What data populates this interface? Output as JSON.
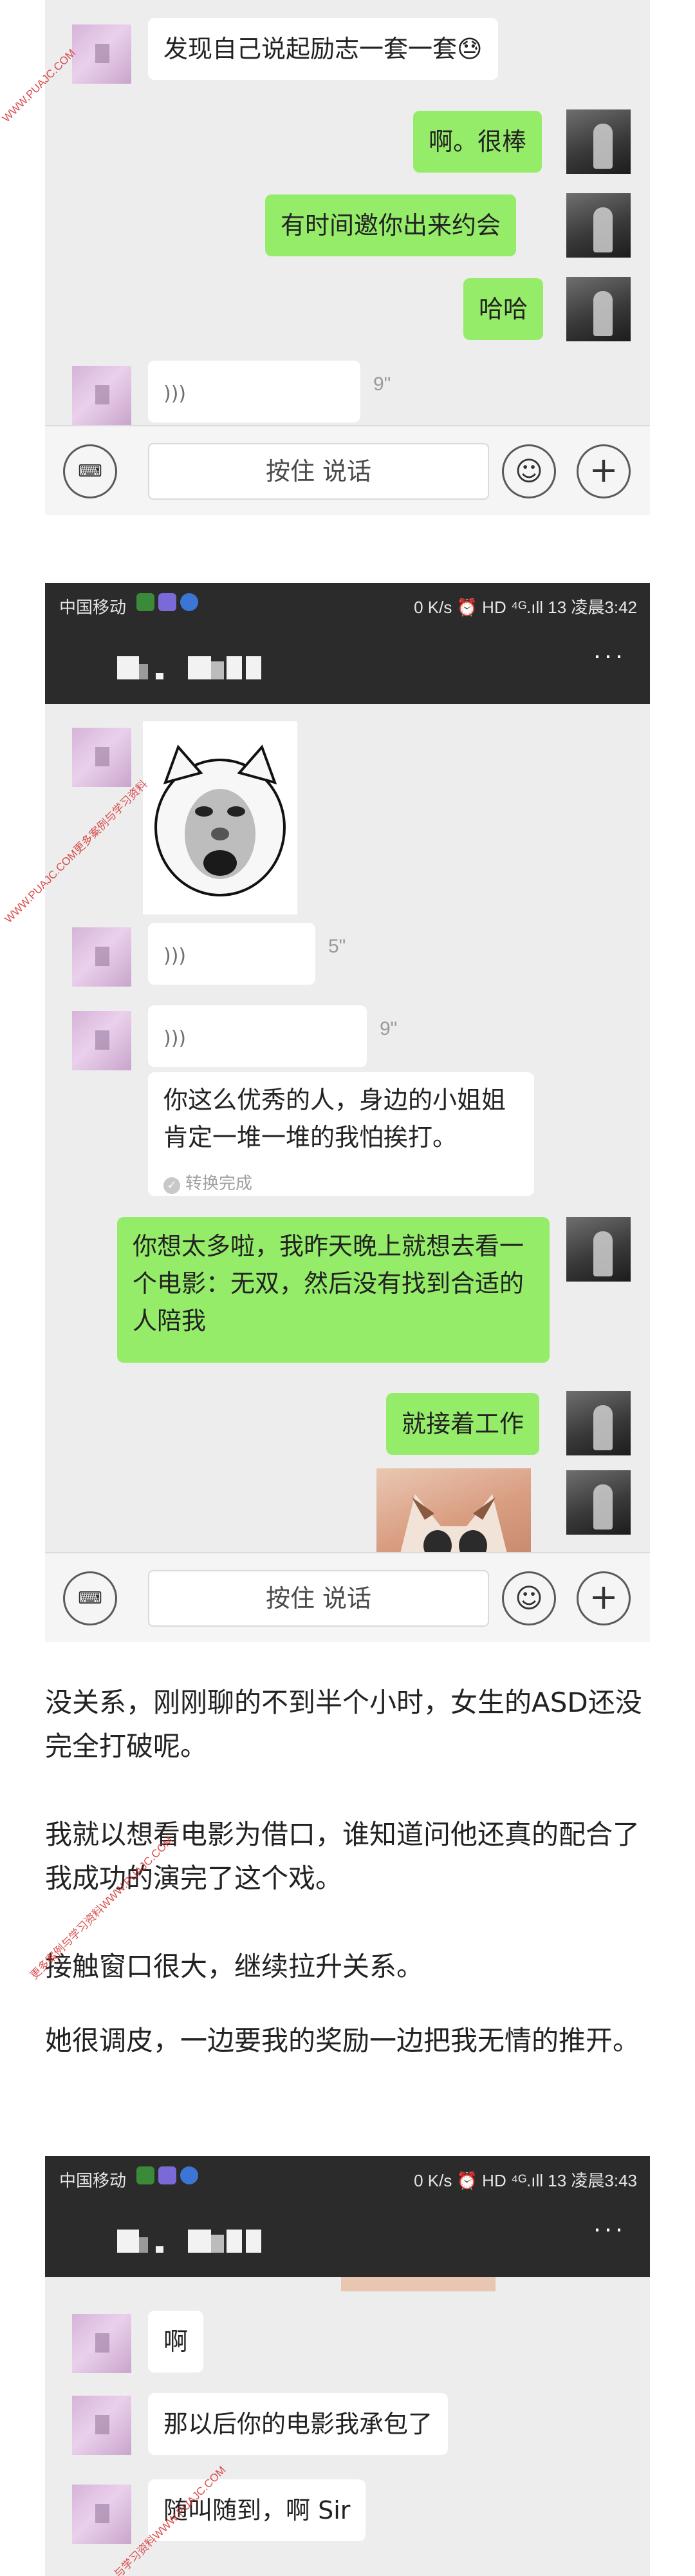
{
  "watermark": {
    "text1": "WWW.PUAJC.COM",
    "text2": "WWW.PUAJC.COM更多案例与学习资料",
    "text3": "更多案例与学习资料WWW.PUAJC.COM",
    "text4": "与学习资料WWW.PUAJC.COM"
  },
  "shot1": {
    "messages": {
      "m1": "发现自己说起励志一套一套😓",
      "m2": "啊。很棒",
      "m3": "有时间邀你出来约会",
      "m4": "哈哈",
      "v1_duration": "9\""
    },
    "input": {
      "hold": "按住 说话"
    }
  },
  "shot2": {
    "status": {
      "carrier": "中国移动",
      "right": "0 K/s ⏰ HD ⁴ᴳ.ıll 13 凌晨3:42"
    },
    "nav": {
      "more": "···"
    },
    "messages": {
      "v1_duration": "5\"",
      "v2_duration": "9\"",
      "converted": "你这么优秀的人，身边的小姐姐肯定一堆一堆的我怕挨打。",
      "converted_status": "转换完成",
      "m_out1": "你想太多啦，我昨天晚上就想去看一个电影：无双，然后没有找到合适的人陪我",
      "m_out2": "就接着工作"
    },
    "input": {
      "hold": "按住 说话"
    }
  },
  "article": {
    "p1": "没关系，刚刚聊的不到半个小时，女生的ASD还没完全打破呢。",
    "p2": "我就以想看电影为借口，谁知道问他还真的配合了我成功的演完了这个戏。",
    "p3": "接触窗口很大，继续拉升关系。",
    "p4": "她很调皮，一边要我的奖励一边把我无情的推开。"
  },
  "shot3": {
    "status": {
      "carrier": "中国移动",
      "right": "0 K/s ⏰ HD ⁴ᴳ.ıll 13 凌晨3:43"
    },
    "nav": {
      "more": "···"
    },
    "messages": {
      "m1": "啊",
      "m2": "那以后你的电影我承包了",
      "m3": "随叫随到，啊 Sir"
    }
  },
  "colors": {
    "out_bubble": "#95ec69",
    "in_bubble": "#ffffff",
    "chat_bg": "#ededed",
    "bar": "#2b2b2b"
  }
}
